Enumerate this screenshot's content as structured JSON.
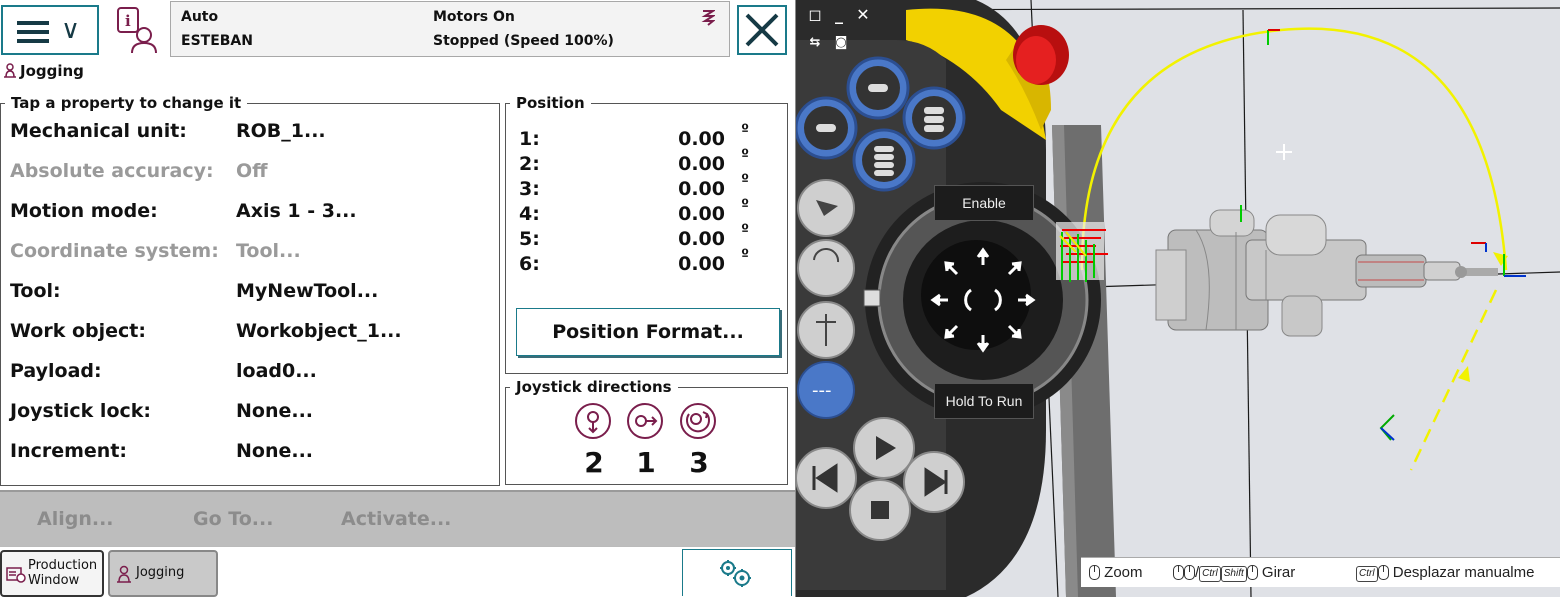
{
  "status": {
    "mode": "Auto",
    "controller": "ESTEBAN",
    "motors": "Motors On",
    "state": "Stopped (Speed 100%)"
  },
  "breadcrumb": "Jogging",
  "properties": {
    "legend": "Tap a property to change it",
    "rows": [
      {
        "label": "Mechanical unit:",
        "value": "ROB_1...",
        "enabled": true
      },
      {
        "label": "Absolute accuracy:",
        "value": "Off",
        "enabled": false
      },
      {
        "label": "Motion mode:",
        "value": "Axis 1 - 3...",
        "enabled": true
      },
      {
        "label": "Coordinate system:",
        "value": "Tool...",
        "enabled": false
      },
      {
        "label": "Tool:",
        "value": "MyNewTool...",
        "enabled": true
      },
      {
        "label": "Work object:",
        "value": "Workobject_1...",
        "enabled": true
      },
      {
        "label": "Payload:",
        "value": "load0...",
        "enabled": true
      },
      {
        "label": "Joystick lock:",
        "value": "None...",
        "enabled": true
      },
      {
        "label": "Increment:",
        "value": "None...",
        "enabled": true
      }
    ]
  },
  "position": {
    "legend": "Position",
    "unit": "º",
    "rows": [
      {
        "n": "1:",
        "v": "0.00"
      },
      {
        "n": "2:",
        "v": "0.00"
      },
      {
        "n": "3:",
        "v": "0.00"
      },
      {
        "n": "4:",
        "v": "0.00"
      },
      {
        "n": "5:",
        "v": "0.00"
      },
      {
        "n": "6:",
        "v": "0.00"
      }
    ],
    "format_button": "Position Format..."
  },
  "joystick": {
    "legend": "Joystick directions",
    "axes": [
      "2",
      "1",
      "3"
    ]
  },
  "actions": {
    "align": "Align...",
    "goto": "Go To...",
    "activate": "Activate..."
  },
  "taskbar": {
    "production_line1": "Production",
    "production_line2": "Window",
    "jogging": "Jogging"
  },
  "view": {
    "enable_label": "Enable",
    "hold_label": "Hold To Run",
    "hint_zoom": "Zoom",
    "hint_ctrl": "Ctrl",
    "hint_shift": "Shift",
    "hint_rotate": "Girar",
    "hint_pan": "Desplazar manualme"
  },
  "colors": {
    "accent": "#1a7a8a",
    "disabled_text": "#9a9a9a",
    "pendant_blue": "#4a78c8",
    "estop_red": "#d81c1c",
    "pendant_yellow": "#f2d100",
    "trajectory": "#f2f200"
  }
}
